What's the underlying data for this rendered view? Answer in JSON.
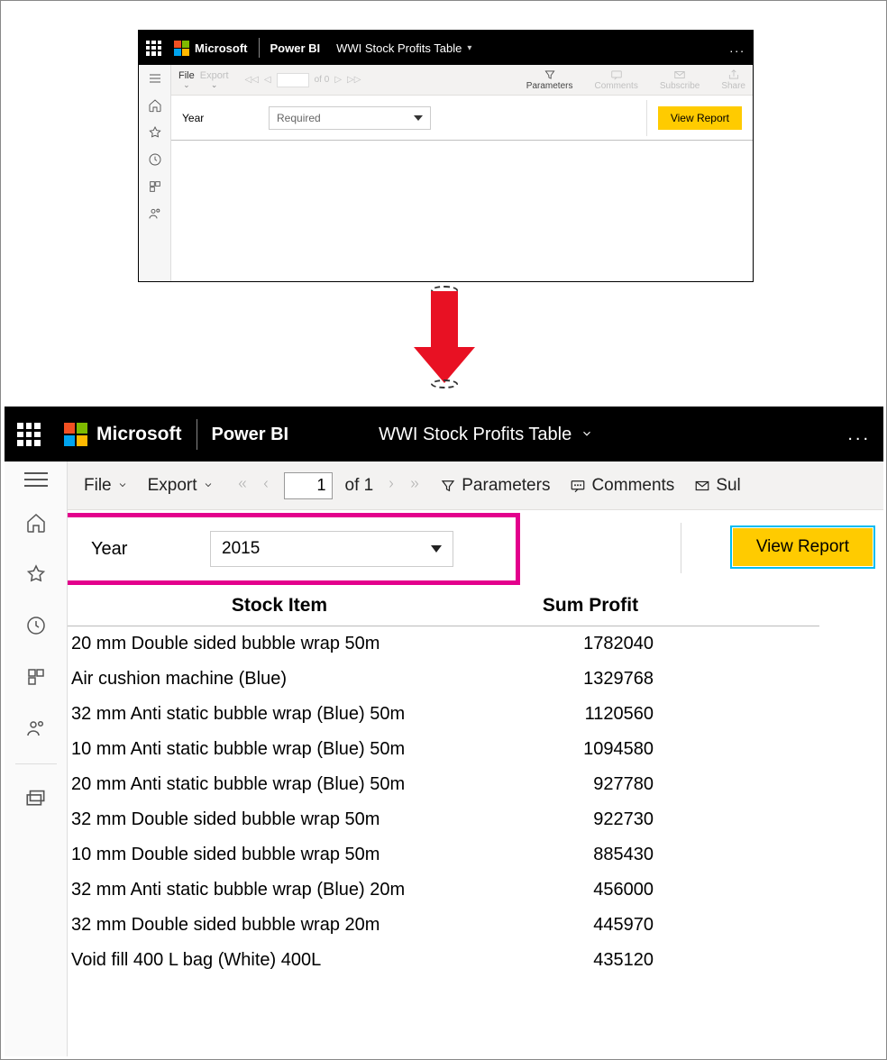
{
  "brand": "Microsoft",
  "product": "Power BI",
  "report_title": "WWI Stock Profits Table",
  "more_dots": "...",
  "small": {
    "toolbar": {
      "file": "File",
      "export": "Export",
      "of_pages": "of 0",
      "parameters": "Parameters",
      "comments": "Comments",
      "subscribe": "Subscribe",
      "share": "Share"
    },
    "param": {
      "label": "Year",
      "placeholder": "Required",
      "button": "View Report"
    }
  },
  "large": {
    "toolbar": {
      "file": "File",
      "export": "Export",
      "current_page": "1",
      "of_pages": "of 1",
      "parameters": "Parameters",
      "comments": "Comments",
      "subscribe": "Sul"
    },
    "param": {
      "label": "Year",
      "value": "2015",
      "button": "View Report"
    },
    "table": {
      "col1": "Stock Item",
      "col2": "Sum Profit",
      "rows": [
        {
          "item": "20 mm Double sided bubble wrap 50m",
          "profit": "1782040"
        },
        {
          "item": "Air cushion machine (Blue)",
          "profit": "1329768"
        },
        {
          "item": "32 mm Anti static bubble wrap (Blue) 50m",
          "profit": "1120560"
        },
        {
          "item": "10 mm Anti static bubble wrap (Blue) 50m",
          "profit": "1094580"
        },
        {
          "item": "20 mm Anti static bubble wrap (Blue) 50m",
          "profit": "927780"
        },
        {
          "item": "32 mm Double sided bubble wrap 50m",
          "profit": "922730"
        },
        {
          "item": "10 mm Double sided bubble wrap 50m",
          "profit": "885430"
        },
        {
          "item": "32 mm Anti static bubble wrap (Blue) 20m",
          "profit": "456000"
        },
        {
          "item": "32 mm Double sided bubble wrap 20m",
          "profit": "445970"
        },
        {
          "item": "Void fill 400 L bag (White) 400L",
          "profit": "435120"
        }
      ]
    }
  }
}
